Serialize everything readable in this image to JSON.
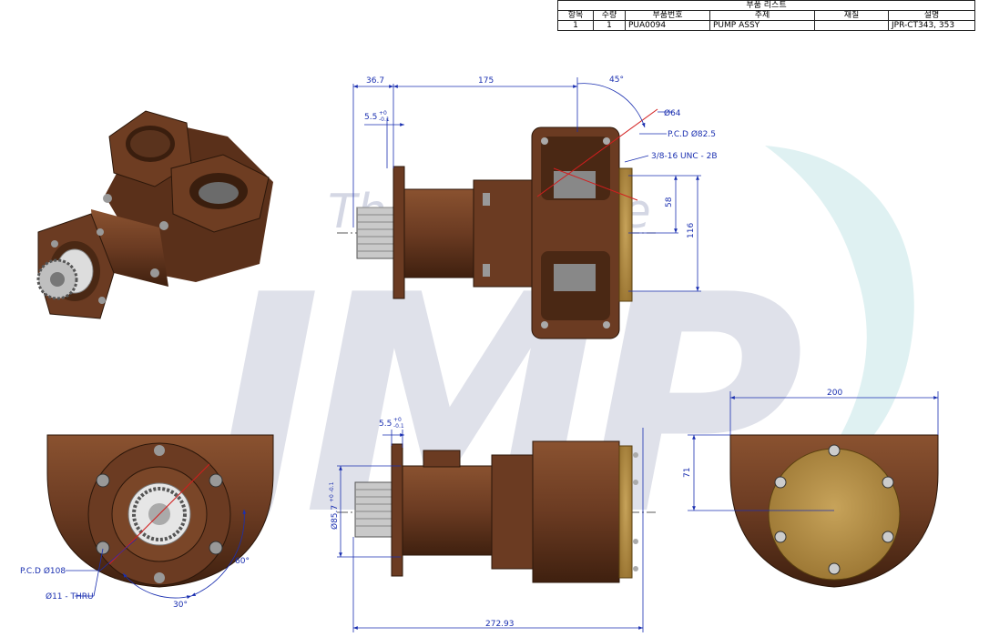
{
  "parts_list": {
    "caption": "부품 리스트",
    "headers": [
      "항목",
      "수량",
      "부품번호",
      "주제",
      "재질",
      "설명"
    ],
    "row": [
      "1",
      "1",
      "PUA0094",
      "PUMP ASSY",
      "",
      "JPR-CT343, 353"
    ]
  },
  "watermark": {
    "logo_text": "JMP",
    "slogan": "The Only One"
  },
  "dimensions": {
    "top_36_7": "36.7",
    "top_175": "175",
    "angle_45": "45°",
    "dia_64": "Ø64",
    "pcd_82_5": "P.C.D Ø82.5",
    "thread": "3/8-16 UNC - 2B",
    "tol_top": "5.5",
    "tol_top_sup": "+0",
    "tol_top_sub": "-0.1",
    "h_58": "58",
    "h_116": "116",
    "tol_front": "5.5",
    "tol_front_sup": "+0",
    "tol_front_sub": "-0.1",
    "dia_85_7": "Ø85.7",
    "dia_85_7_tol": "+0 -0.1",
    "len_272_93": "272.93",
    "w_200": "200",
    "h_71": "71",
    "pcd_108": "P.C.D Ø108",
    "hole_11": "Ø11 - THRU",
    "angle_60": "60°",
    "angle_30": "30°"
  },
  "colors": {
    "body": "#6b3b22",
    "body_dark": "#3f200f",
    "body_light": "#8a5230",
    "brass": "#b08a3e",
    "dim_blue": "#1a2fb0",
    "center_red": "#d21e1e",
    "watermark_gray": "#d9dbe6",
    "watermark_teal": "#dff1f2"
  }
}
